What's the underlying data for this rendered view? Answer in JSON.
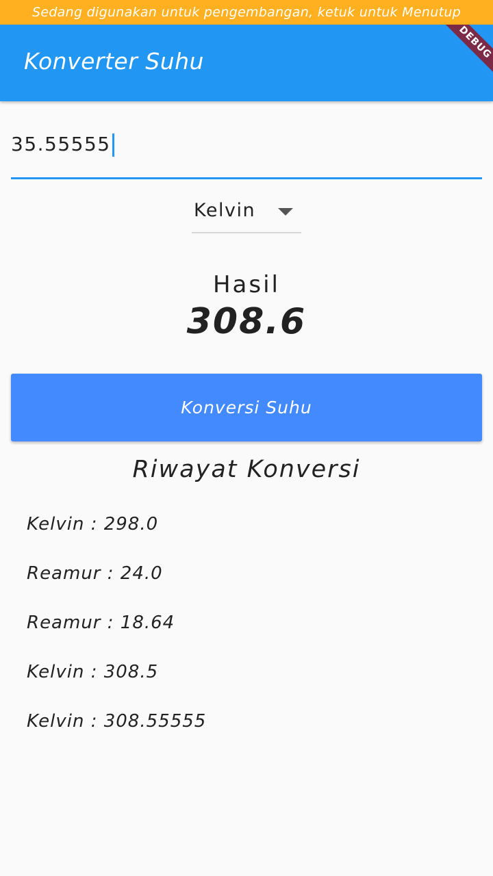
{
  "status_banner": "Sedang digunakan untuk pengembangan, ketuk untuk Menutup",
  "app_bar": {
    "title": "Konverter Suhu",
    "debug_ribbon": "DEBUG",
    "color": "#2196f3"
  },
  "input": {
    "value": "35.55555"
  },
  "unit_dropdown": {
    "selected": "Kelvin",
    "icon": "arrow-drop-down-icon"
  },
  "result": {
    "label": "Hasil",
    "value": "308.6"
  },
  "convert_button": {
    "label": "Konversi Suhu",
    "color": "#448aff"
  },
  "history": {
    "title": "Riwayat Konversi",
    "items": [
      "Kelvin : 298.0",
      "Reamur : 24.0",
      "Reamur : 18.64",
      "Kelvin : 308.5",
      "Kelvin : 308.55555"
    ]
  }
}
